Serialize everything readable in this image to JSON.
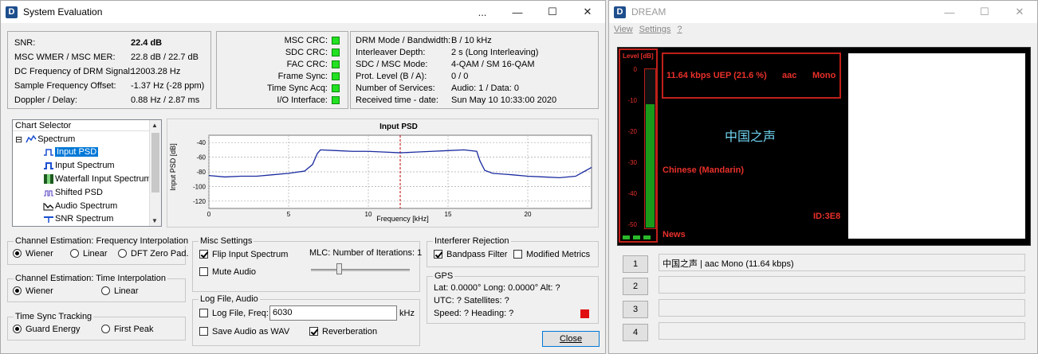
{
  "win1": {
    "title": "System Evaluation",
    "controls": {
      "menu": "...",
      "minimize": "—",
      "maximize": "☐",
      "close": "✕"
    },
    "stats": [
      {
        "label": "SNR:",
        "value": "22.4 dB"
      },
      {
        "label": "MSC WMER / MSC MER:",
        "value": "22.8 dB / 22.7 dB"
      },
      {
        "label": "DC Frequency of DRM Signal:",
        "value": "12003.28 Hz"
      },
      {
        "label": "Sample Frequency Offset:",
        "value": "-1.37 Hz (-28 ppm)"
      },
      {
        "label": "Doppler / Delay:",
        "value": "0.88 Hz / 2.87 ms"
      }
    ],
    "status_labels": [
      "MSC CRC:",
      "SDC CRC:",
      "FAC CRC:",
      "Frame Sync:",
      "Time Sync Acq:",
      "I/O Interface:"
    ],
    "status_color": "#22e022",
    "drm": [
      {
        "label": "DRM Mode / Bandwidth:",
        "value": "B / 10 kHz"
      },
      {
        "label": "Interleaver Depth:",
        "value": "2 s (Long Interleaving)"
      },
      {
        "label": "SDC / MSC Mode:",
        "value": "4-QAM / SM 16-QAM"
      },
      {
        "label": "Prot. Level (B / A):",
        "value": "0 / 0"
      },
      {
        "label": "Number of Services:",
        "value": "Audio: 1 / Data: 0"
      },
      {
        "label": "Received time - date:",
        "value": "Sun May 10 10:33:00 2020"
      }
    ],
    "chart_selector": {
      "header": "Chart Selector",
      "toggle": "⊟",
      "root": "Spectrum",
      "items": [
        "Input PSD",
        "Input Spectrum",
        "Waterfall Input Spectrum",
        "Shifted PSD",
        "Audio Spectrum",
        "SNR Spectrum"
      ]
    },
    "freq_interp": {
      "title": "Channel Estimation: Frequency Interpolation",
      "options": [
        "Wiener",
        "Linear",
        "DFT Zero Pad."
      ]
    },
    "time_interp": {
      "title": "Channel Estimation: Time Interpolation",
      "options": [
        "Wiener",
        "Linear"
      ]
    },
    "time_sync": {
      "title": "Time Sync Tracking",
      "options": [
        "Guard Energy",
        "First Peak"
      ]
    },
    "misc": {
      "title": "Misc Settings",
      "flip": "Flip Input Spectrum",
      "mute": "Mute Audio",
      "mlc": "MLC: Number of Iterations: 1",
      "mlc_iterations": 1
    },
    "logfile": {
      "title": "Log File, Audio",
      "log_label": "Log File, Freq:",
      "freq_value": "6030",
      "unit": "kHz",
      "save_wav": "Save Audio as WAV",
      "reverb": "Reverberation"
    },
    "interferer": {
      "title": "Interferer Rejection",
      "bandpass": "Bandpass Filter",
      "modified": "Modified Metrics"
    },
    "gps": {
      "title": "GPS",
      "line1": "Lat: 0.0000°    Long: 0.0000°    Alt: ?",
      "line2": "UTC: ?  Satellites: ?",
      "line3": "Speed: ?  Heading: ?",
      "indicator_color": "#e01010"
    },
    "close_label": "Close"
  },
  "chart_data": {
    "type": "line",
    "title": "Input PSD",
    "xlabel": "Frequency [kHz]",
    "ylabel": "Input PSD [dB]",
    "xlim": [
      0,
      24
    ],
    "ylim": [
      -130,
      -30
    ],
    "xticks": [
      0,
      5,
      10,
      15,
      20
    ],
    "yticks": [
      -40,
      -60,
      -80,
      -100,
      -120
    ],
    "grid": true,
    "marker_x": 12,
    "series": [
      {
        "color": "#1a2aa0",
        "x": [
          0,
          1,
          2,
          3,
          4,
          5,
          6,
          6.5,
          6.8,
          7,
          8,
          9,
          10,
          11,
          12,
          13,
          14,
          15,
          16,
          16.8,
          17,
          17.3,
          17.8,
          19,
          20,
          21,
          22,
          23,
          23.5,
          24
        ],
        "y": [
          -85,
          -87,
          -86,
          -86,
          -84,
          -82,
          -79,
          -70,
          -55,
          -50,
          -51,
          -52,
          -52,
          -53,
          -54,
          -53,
          -52,
          -51,
          -50,
          -52,
          -65,
          -78,
          -82,
          -84,
          -86,
          -87,
          -88,
          -86,
          -80,
          -74
        ]
      }
    ]
  },
  "win2": {
    "title": "DREAM",
    "controls": {
      "minimize": "—",
      "maximize": "☐",
      "close": "✕"
    },
    "menu": [
      "View",
      "Settings",
      "?"
    ],
    "level_label": "Level [dB]",
    "level_ticks": [
      "0",
      "-10",
      "-20",
      "-30",
      "-40",
      "-50"
    ],
    "level_value_db": -12,
    "bitrate_text": "11.64 kbps UEP (21.6 %)",
    "codec": "aac",
    "channel": "Mono",
    "station": "中国之声",
    "language": "Chinese (Mandarin)",
    "station_id": "ID:3E8",
    "program_type": "News",
    "services": [
      {
        "num": "1",
        "text": "中国之声  |   aac Mono (11.64 kbps)"
      },
      {
        "num": "2",
        "text": ""
      },
      {
        "num": "3",
        "text": ""
      },
      {
        "num": "4",
        "text": ""
      }
    ]
  }
}
